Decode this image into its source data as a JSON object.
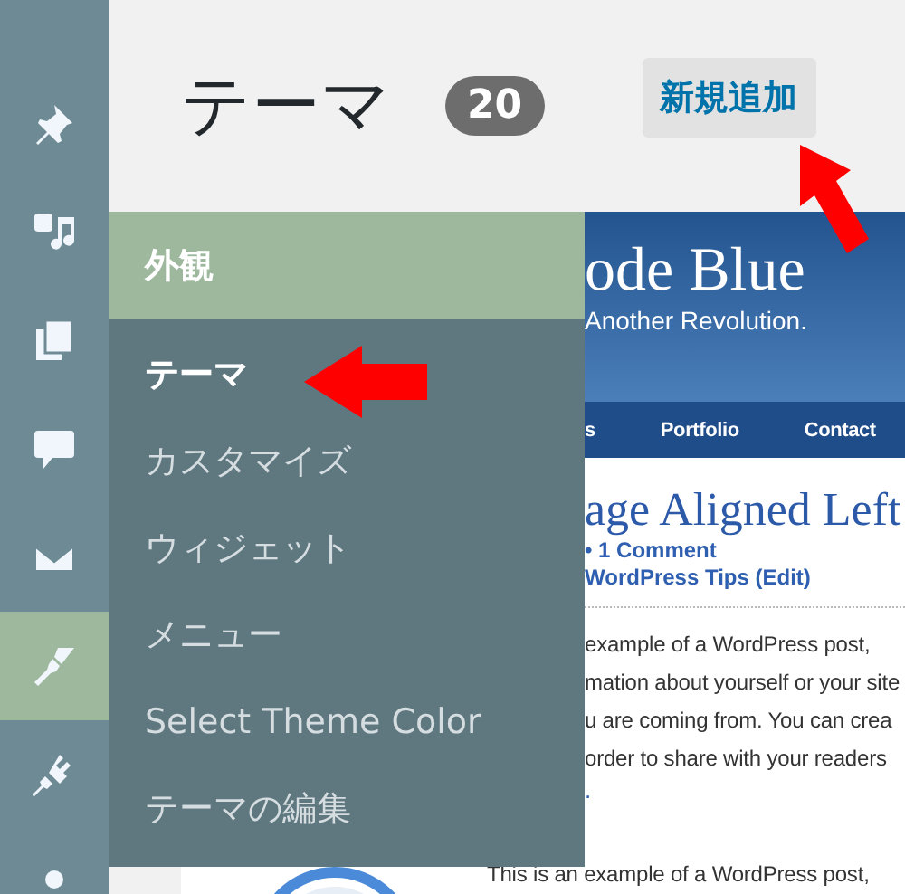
{
  "sidebar": {
    "items": [
      {
        "kind": "pin",
        "selected": false
      },
      {
        "kind": "media",
        "selected": false
      },
      {
        "kind": "pages",
        "selected": false
      },
      {
        "kind": "comments",
        "selected": false
      },
      {
        "kind": "mail",
        "selected": false
      },
      {
        "kind": "appearance",
        "selected": true
      },
      {
        "kind": "plugins",
        "selected": false
      },
      {
        "kind": "users",
        "selected": false
      }
    ]
  },
  "header": {
    "title": "テーマ",
    "count": "20",
    "add_button": "新規追加"
  },
  "flyout": {
    "title": "外観",
    "items": [
      {
        "label": "テーマ",
        "selected": true
      },
      {
        "label": "カスタマイズ",
        "selected": false
      },
      {
        "label": "ウィジェット",
        "selected": false
      },
      {
        "label": "メニュー",
        "selected": false
      },
      {
        "label": "Select Theme Color",
        "selected": false
      },
      {
        "label": "テーマの編集",
        "selected": false
      }
    ]
  },
  "preview": {
    "site_title": "ode Blue",
    "tagline": "Another Revolution.",
    "nav": [
      "s",
      "Portfolio",
      "Contact"
    ],
    "post_title": "age Aligned Left",
    "meta": [
      "• 1 Comment",
      "WordPress Tips (Edit)"
    ],
    "paragraph_lines": [
      "example of a WordPress post,",
      "mation about yourself or your site",
      "u are coming from. You can crea",
      "order to share with your readers"
    ],
    "link": ".",
    "next_line": "This is an example of a WordPress post,"
  }
}
